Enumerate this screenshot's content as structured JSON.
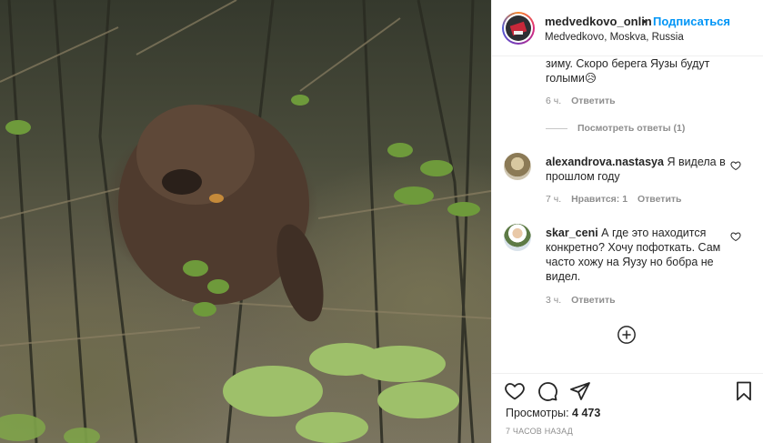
{
  "post": {
    "username": "medvedkovo_onlin",
    "separator": "•",
    "follow_label": "Подписаться",
    "location": "Medvedkovo, Moskva, Russia"
  },
  "comments": {
    "first": {
      "text": "зиму. Скоро берега Яузы будут голыми😥",
      "age": "6 ч.",
      "reply_label": "Ответить",
      "view_replies_label": "Посмотреть ответы (1)"
    },
    "items": [
      {
        "username": "alexandrova.nastasya",
        "text": "Я видела в прошлом году",
        "age": "7 ч.",
        "likes_label": "Нравится: 1",
        "reply_label": "Ответить"
      },
      {
        "username": "skar_ceni",
        "text": "А где это находится конкретно? Хочу пофоткать. Сам часто хожу на Яузу но бобра не видел.",
        "age": "3 ч.",
        "reply_label": "Ответить"
      }
    ]
  },
  "icons": {
    "like": "heart-icon",
    "comment": "comment-icon",
    "share": "paper-plane-icon",
    "save": "bookmark-icon",
    "load_more": "plus-circle-icon",
    "comment_like": "heart-icon"
  },
  "stats": {
    "views_label": "Просмотры:",
    "views_count": "4 473",
    "posted_ago": "7 ЧАСОВ НАЗАД"
  },
  "colors": {
    "accent": "#0095f6",
    "text": "#262626",
    "muted": "#8e8e8e",
    "border": "#efefef"
  }
}
